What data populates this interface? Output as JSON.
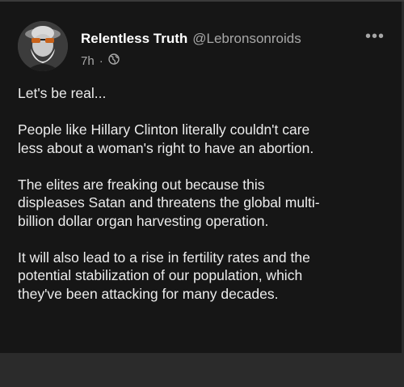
{
  "post": {
    "author_name": "Relentless Truth",
    "author_handle": "@Lebronsonroids",
    "time": "7h",
    "separator": "·",
    "visibility_icon": "globe-icon",
    "more_icon": "more-options-icon",
    "paragraphs": [
      "Let's be real...",
      "People like Hillary Clinton literally couldn't care\nless about a woman's right to have an abortion.",
      "The elites are freaking out because this\ndispleases Satan and threatens the global multi-\nbillion dollar organ harvesting operation.",
      "It will also lead to a rise in fertility rates and the\npotential stabilization of our population, which\nthey've been attacking for many decades."
    ]
  },
  "colors": {
    "card_background": "#161616",
    "text_primary": "#ececec",
    "text_secondary": "#a7a7a7"
  }
}
